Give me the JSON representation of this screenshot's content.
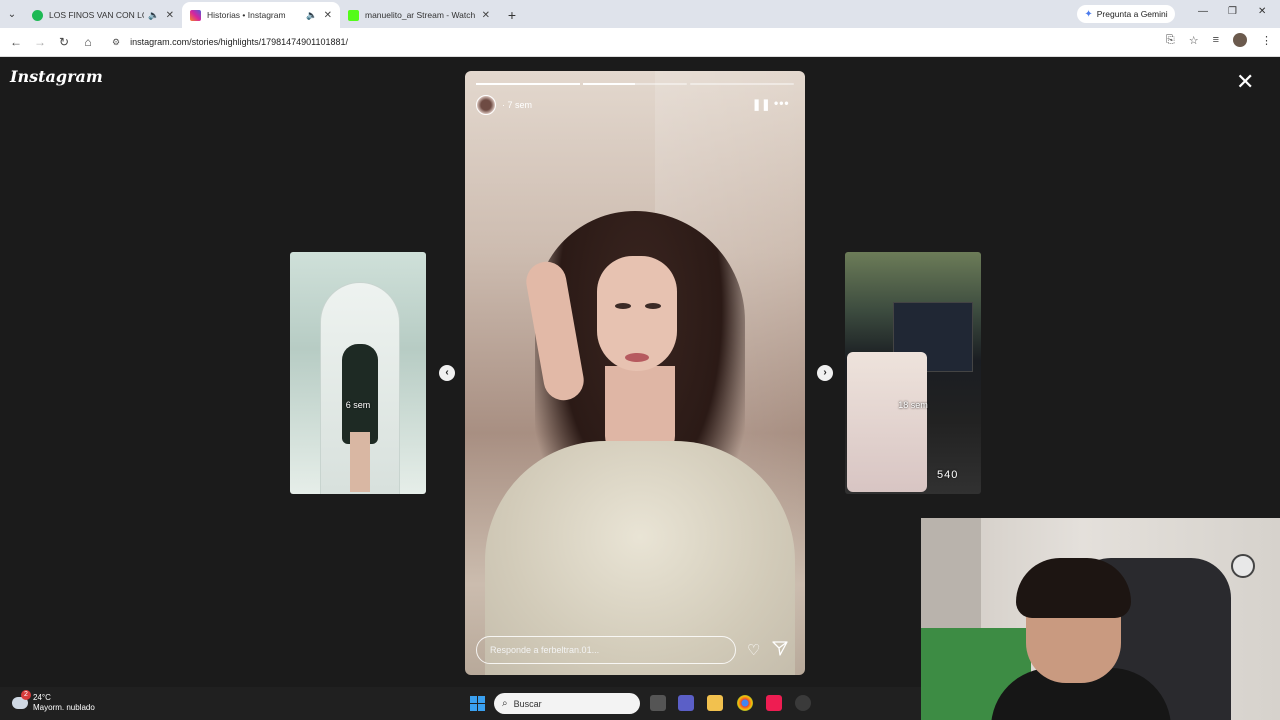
{
  "browser": {
    "tabs": [
      {
        "title": "LOS FINOS VAN CON LOS F",
        "active": false,
        "favicon_color": "#1db954"
      },
      {
        "title": "Historias • Instagram",
        "active": true,
        "favicon_color": "#d6249f"
      },
      {
        "title": "manuelito_ar Stream - Watch Li",
        "active": false,
        "favicon_color": "#53fc18"
      }
    ],
    "new_tab": "+",
    "gemini_label": "Pregunta a Gemini",
    "url": "instagram.com/stories/highlights/17981474901101881/"
  },
  "page": {
    "logo": "Instagram",
    "close": "✕"
  },
  "story": {
    "time": "7 sem",
    "progress": [
      1.0,
      0.5,
      0.0
    ],
    "reply_placeholder": "Responde a ferbeltran.01..."
  },
  "thumbnails": {
    "left_label": "6 sem",
    "right_label": "18 sem",
    "right_count": "540"
  },
  "taskbar": {
    "temperature": "24°C",
    "weather_desc": "Mayorm. nublado",
    "notification_count": "2",
    "search_label": "Buscar"
  },
  "colors": {
    "accent_spotify": "#1db954",
    "accent_instagram": "#d6249f",
    "accent_kick": "#53fc18",
    "windows_blue": "#3aa0f0"
  }
}
